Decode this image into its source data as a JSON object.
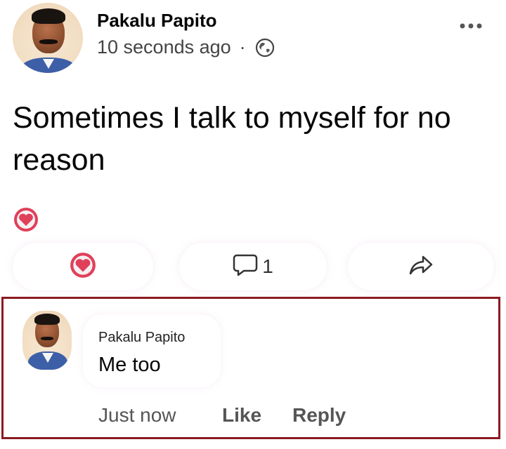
{
  "post": {
    "author": "Pakalu Papito",
    "timestamp": "10 seconds ago",
    "separator": "·",
    "privacy_icon": "globe-icon",
    "more_icon": "more-options-icon",
    "text": "Sometimes I talk to myself for no reason",
    "reaction_icon": "heart-reaction-icon",
    "colors": {
      "heart": "#e0405a",
      "comment_box_border": "#8b1a22"
    }
  },
  "actions": {
    "like_icon": "heart-icon",
    "comment_icon": "comment-icon",
    "comment_count": "1",
    "share_icon": "share-icon"
  },
  "comment": {
    "author": "Pakalu Papito",
    "text": "Me too",
    "time": "Just now",
    "like_label": "Like",
    "reply_label": "Reply"
  }
}
